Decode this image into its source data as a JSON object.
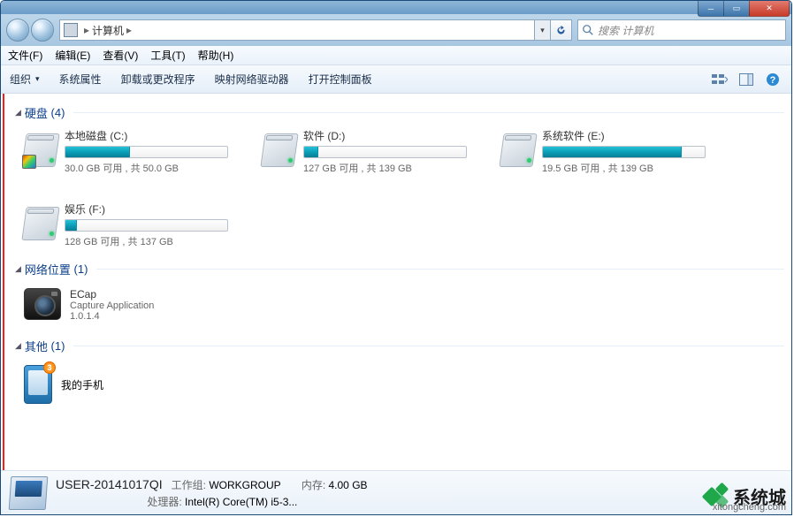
{
  "address": {
    "location": "计算机",
    "sep": "▸"
  },
  "search": {
    "placeholder": "搜索 计算机"
  },
  "menu": {
    "file": "文件(F)",
    "edit": "编辑(E)",
    "view": "查看(V)",
    "tools": "工具(T)",
    "help": "帮助(H)"
  },
  "toolbar": {
    "organize": "组织",
    "sys_props": "系统属性",
    "uninstall": "卸载或更改程序",
    "map_drive": "映射网络驱动器",
    "control_panel": "打开控制面板"
  },
  "groups": {
    "hdd": {
      "title": "硬盘",
      "count": 4
    },
    "net": {
      "title": "网络位置",
      "count": 1
    },
    "other": {
      "title": "其他",
      "count": 1
    }
  },
  "drives": {
    "c": {
      "name": "本地磁盘 (C:)",
      "stat": "30.0 GB 可用 , 共 50.0 GB",
      "fill_pct": 40
    },
    "d": {
      "name": "软件 (D:)",
      "stat": "127 GB 可用 , 共 139 GB",
      "fill_pct": 9
    },
    "e": {
      "name": "系统软件 (E:)",
      "stat": "19.5 GB 可用 , 共 139 GB",
      "fill_pct": 86
    },
    "f": {
      "name": "娱乐 (F:)",
      "stat": "128 GB 可用 , 共 137 GB",
      "fill_pct": 7
    }
  },
  "netloc": {
    "ecap": {
      "name": "ECap",
      "desc": "Capture Application",
      "version": "1.0.1.4"
    }
  },
  "other_items": {
    "phone": {
      "name": "我的手机",
      "badge": "3"
    }
  },
  "status": {
    "computer_name": "USER-20141017QI",
    "workgroup_label": "工作组:",
    "workgroup": "WORKGROUP",
    "processor_label": "处理器:",
    "processor": "Intel(R) Core(TM) i5-3...",
    "memory_label": "内存:",
    "memory": "4.00 GB"
  },
  "watermark": {
    "brand": "系统城",
    "url": "xitongcheng.com"
  }
}
